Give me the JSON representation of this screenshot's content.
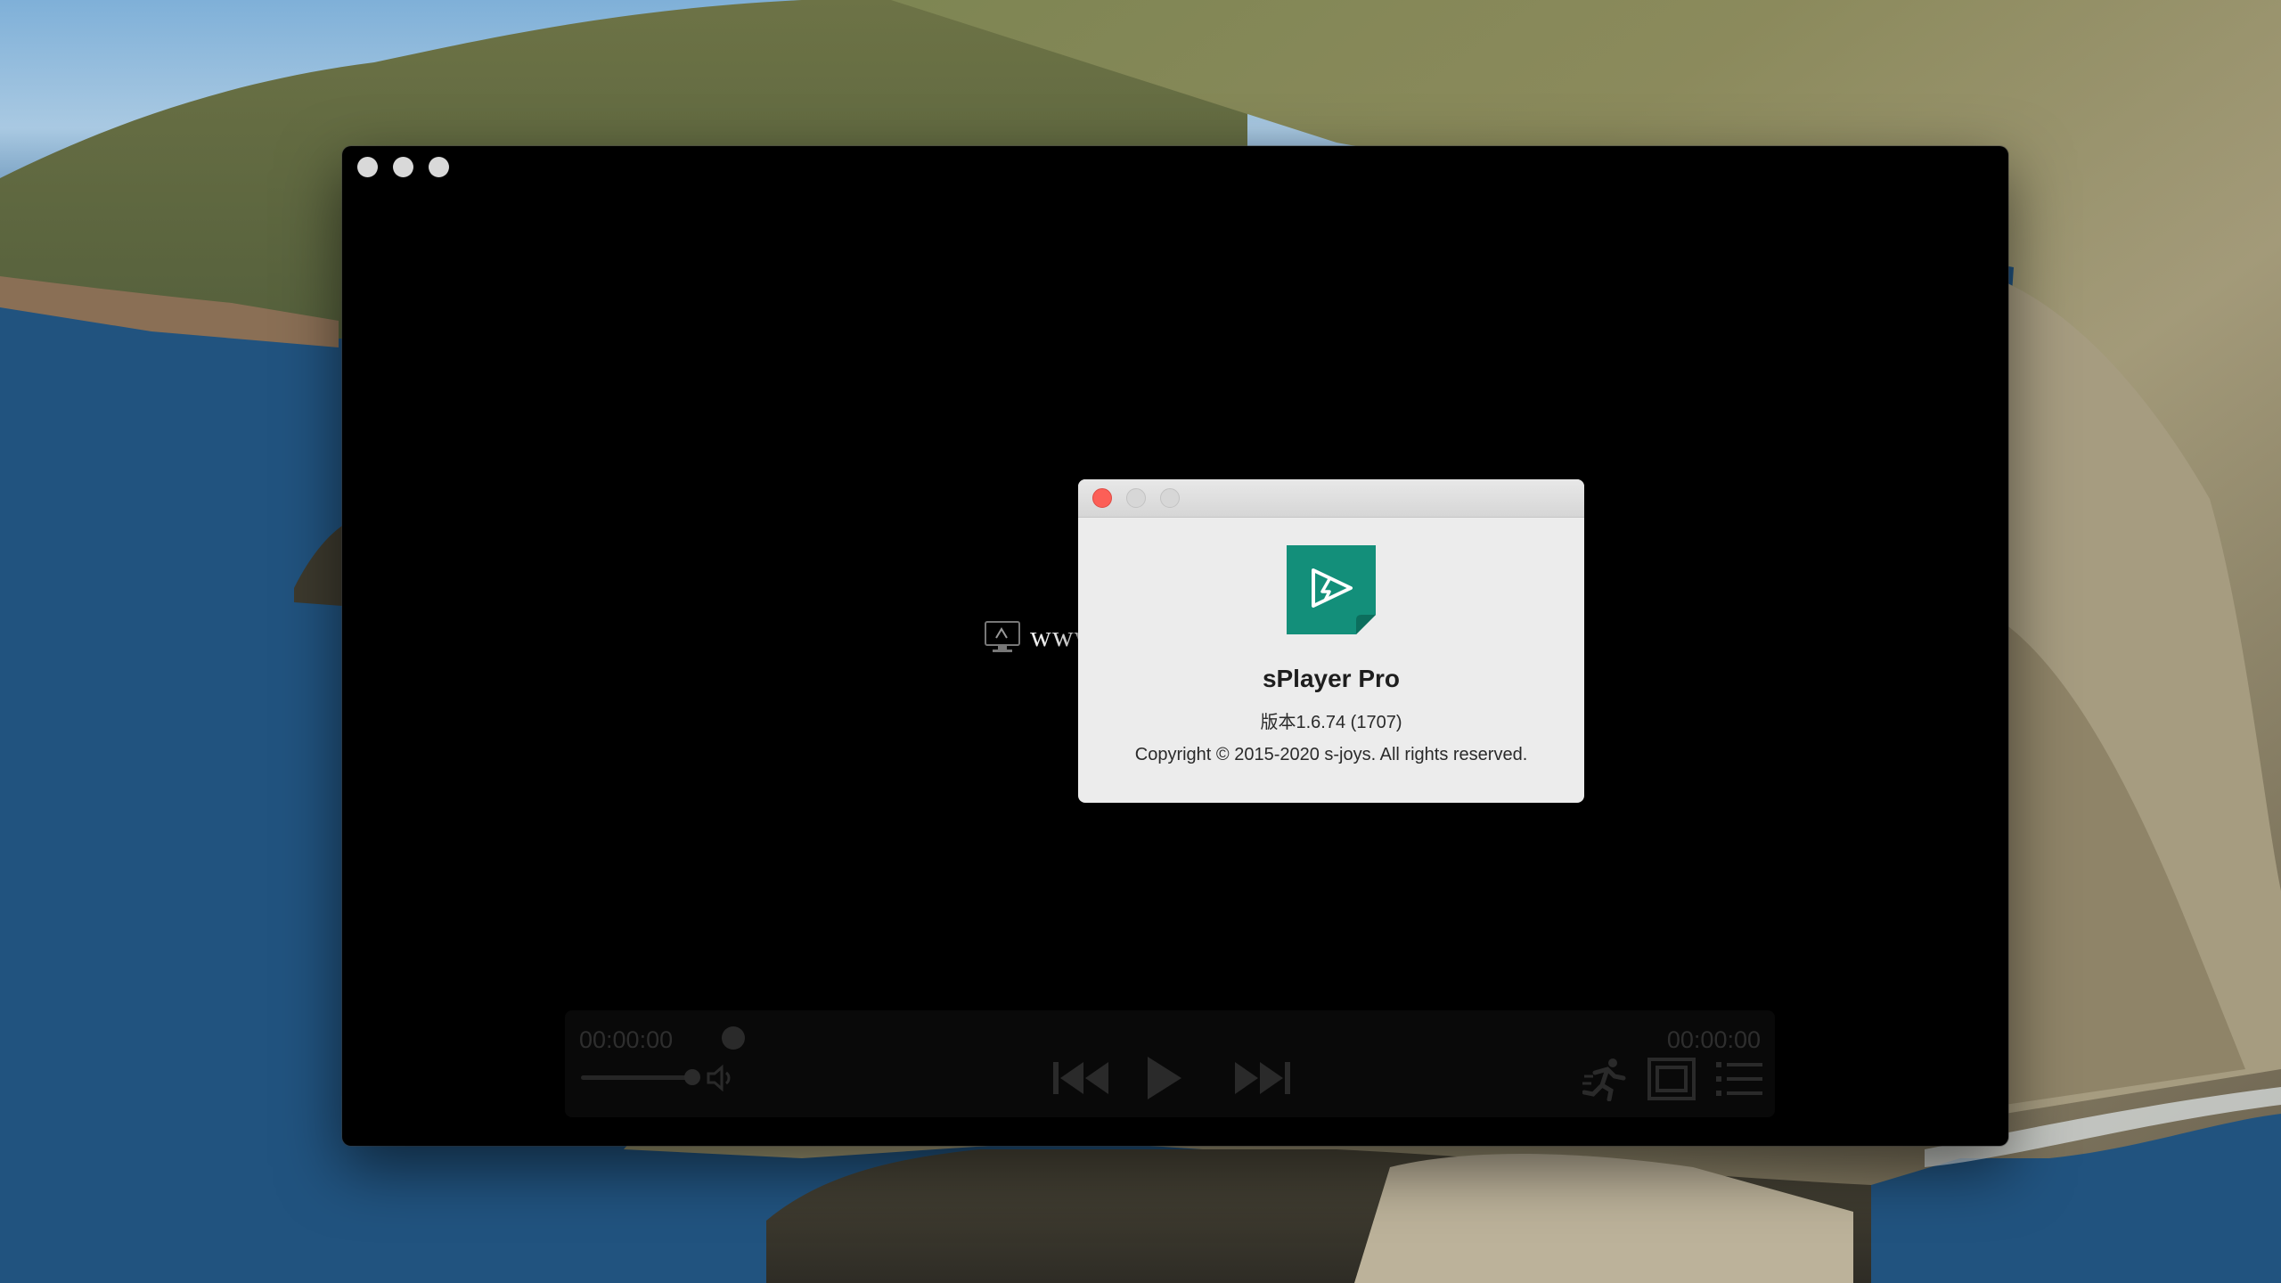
{
  "player": {
    "traffic_lights": [
      "close",
      "minimize",
      "zoom"
    ],
    "control_bar": {
      "time_elapsed": "00:00:00",
      "time_total": "00:00:00",
      "icons": [
        "volume-icon",
        "previous-icon",
        "play-icon",
        "next-icon",
        "running-man-icon",
        "fullscreen-icon",
        "playlist-icon"
      ]
    }
  },
  "about": {
    "app_name": "sPlayer Pro",
    "version": "版本1.6.74 (1707)",
    "copyright": "Copyright © 2015-2020 s-joys. All rights reserved.",
    "icon_color": "#138f7a"
  },
  "watermark": {
    "text": "www.MacW.com"
  }
}
